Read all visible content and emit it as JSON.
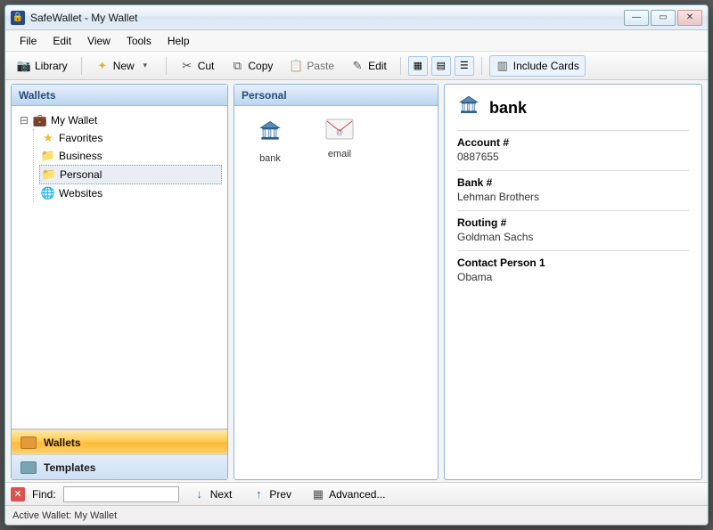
{
  "window": {
    "title": "SafeWallet - My Wallet"
  },
  "menu": {
    "file": "File",
    "edit": "Edit",
    "view": "View",
    "tools": "Tools",
    "help": "Help"
  },
  "toolbar": {
    "library": "Library",
    "new": "New",
    "cut": "Cut",
    "copy": "Copy",
    "paste": "Paste",
    "edit": "Edit",
    "include_cards": "Include Cards"
  },
  "left_panel": {
    "title": "Wallets",
    "root": "My Wallet",
    "items": [
      {
        "label": "Favorites",
        "icon": "star"
      },
      {
        "label": "Business",
        "icon": "folder"
      },
      {
        "label": "Personal",
        "icon": "folder",
        "selected": true
      },
      {
        "label": "Websites",
        "icon": "globe"
      }
    ],
    "nav": {
      "wallets": "Wallets",
      "templates": "Templates"
    }
  },
  "middle_panel": {
    "title": "Personal",
    "items": [
      {
        "label": "bank",
        "icon": "bank",
        "selected": true
      },
      {
        "label": "email",
        "icon": "email"
      }
    ]
  },
  "detail": {
    "title": "bank",
    "fields": [
      {
        "label": "Account #",
        "value": "0887655"
      },
      {
        "label": "Bank #",
        "value": "Lehman Brothers"
      },
      {
        "label": "Routing #",
        "value": "Goldman Sachs"
      },
      {
        "label": "Contact Person 1",
        "value": "Obama"
      }
    ]
  },
  "findbar": {
    "find_label": "Find:",
    "next": "Next",
    "prev": "Prev",
    "advanced": "Advanced..."
  },
  "status": {
    "text": "Active Wallet: My Wallet"
  }
}
